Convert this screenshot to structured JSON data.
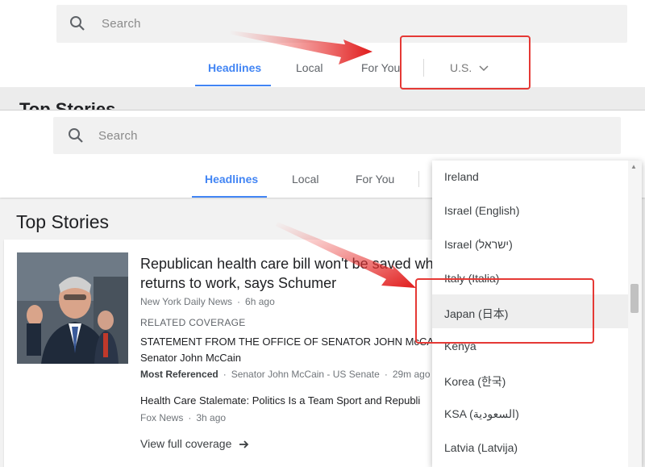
{
  "top_panel": {
    "search_placeholder": "Search",
    "tabs": [
      {
        "label": "Headlines"
      },
      {
        "label": "Local"
      },
      {
        "label": "For You"
      }
    ],
    "edition_label": "U.S.",
    "section_title_cut": "Top Stories"
  },
  "bottom_panel": {
    "search_placeholder": "Search",
    "tabs": [
      {
        "label": "Headlines"
      },
      {
        "label": "Local"
      },
      {
        "label": "For You"
      }
    ],
    "section_title": "Top Stories",
    "story": {
      "headline_line1": "Republican health care bill won't be saved whe",
      "headline_line2": "returns to work, says Schumer",
      "source": "New York Daily News",
      "time": "6h ago",
      "related_label": "RELATED COVERAGE",
      "related1_line1": "STATEMENT FROM THE OFFICE OF SENATOR JOHN McCAI",
      "related1_line2": "Senator John McCain",
      "related1_badge": "Most Referenced",
      "related1_source": "Senator John McCain - US Senate",
      "related1_time": "29m ago",
      "related2_title": "Health Care Stalemate: Politics Is a Team Sport and Republi",
      "related2_source": "Fox News",
      "related2_time": "3h ago",
      "view_full": "View full coverage"
    },
    "dropdown_items": [
      {
        "label": "Ireland"
      },
      {
        "label": "Israel (English)"
      },
      {
        "label": "Israel (ישראל)"
      },
      {
        "label": "Italy (Italia)"
      },
      {
        "label": "Japan (日本)"
      },
      {
        "label": "Kenya"
      },
      {
        "label": "Korea (한국)"
      },
      {
        "label": "KSA (السعودية)"
      },
      {
        "label": "Latvia (Latvija)"
      }
    ]
  },
  "colors": {
    "accent": "#4285f4",
    "annotation_red": "#e53935"
  },
  "icons": [
    "search-icon",
    "chevron-down-icon",
    "arrow-right-icon",
    "annotation-arrow"
  ]
}
